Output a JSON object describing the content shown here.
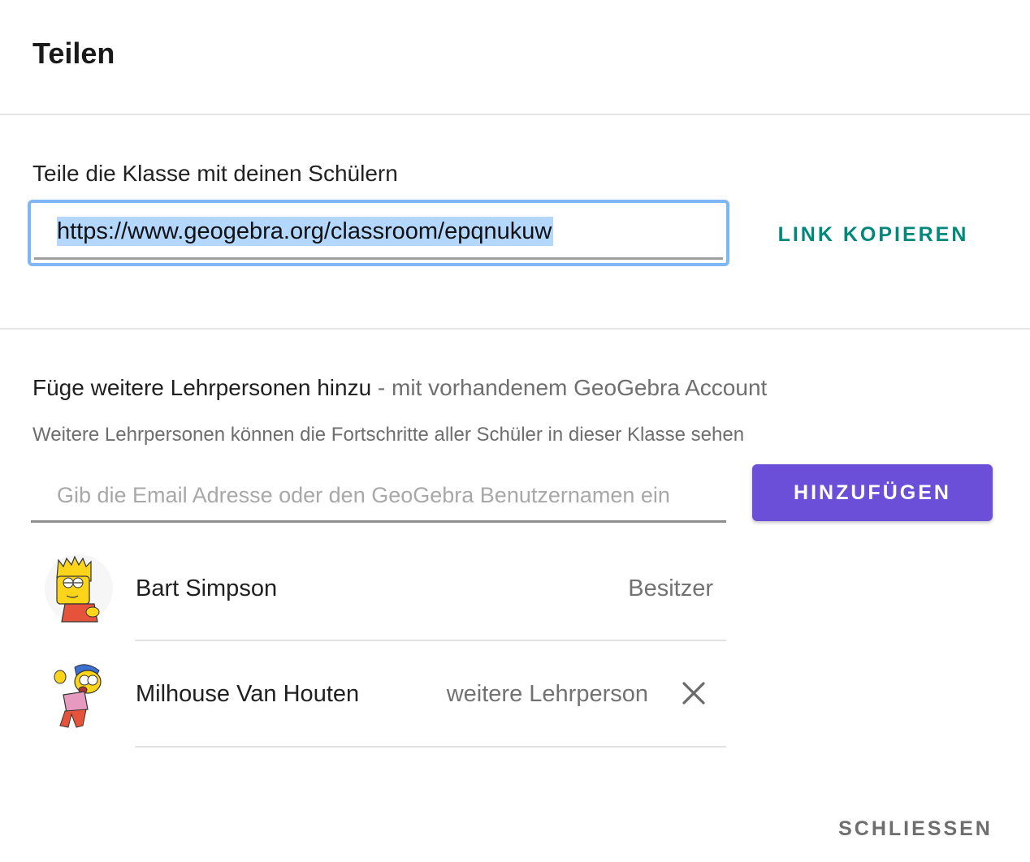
{
  "dialog": {
    "title": "Teilen",
    "close_label": "SCHLIESSEN"
  },
  "share_students": {
    "label": "Teile die Klasse mit deinen Schülern",
    "link": "https://www.geogebra.org/classroom/epqnukuw",
    "copy_label": "LINK KOPIEREN"
  },
  "teachers": {
    "heading_main": "Füge weitere Lehrpersonen hinzu",
    "heading_sub": " - mit vorhandenem GeoGebra Account",
    "description": "Weitere Lehrpersonen können die Fortschritte aller Schüler in dieser Klasse sehen",
    "input_placeholder": "Gib die Email Adresse oder den GeoGebra Benutzernamen ein",
    "input_value": "",
    "add_label": "HINZUFÜGEN",
    "members": [
      {
        "name": "Bart Simpson",
        "role": "Besitzer",
        "removable": false
      },
      {
        "name": "Milhouse Van Houten",
        "role": "weitere Lehrperson",
        "removable": true
      }
    ]
  },
  "colors": {
    "accent_teal": "#00897b",
    "primary_purple": "#6b4fd8",
    "focus_blue": "#7eb6f6",
    "selection_blue": "#b3d7fe"
  }
}
